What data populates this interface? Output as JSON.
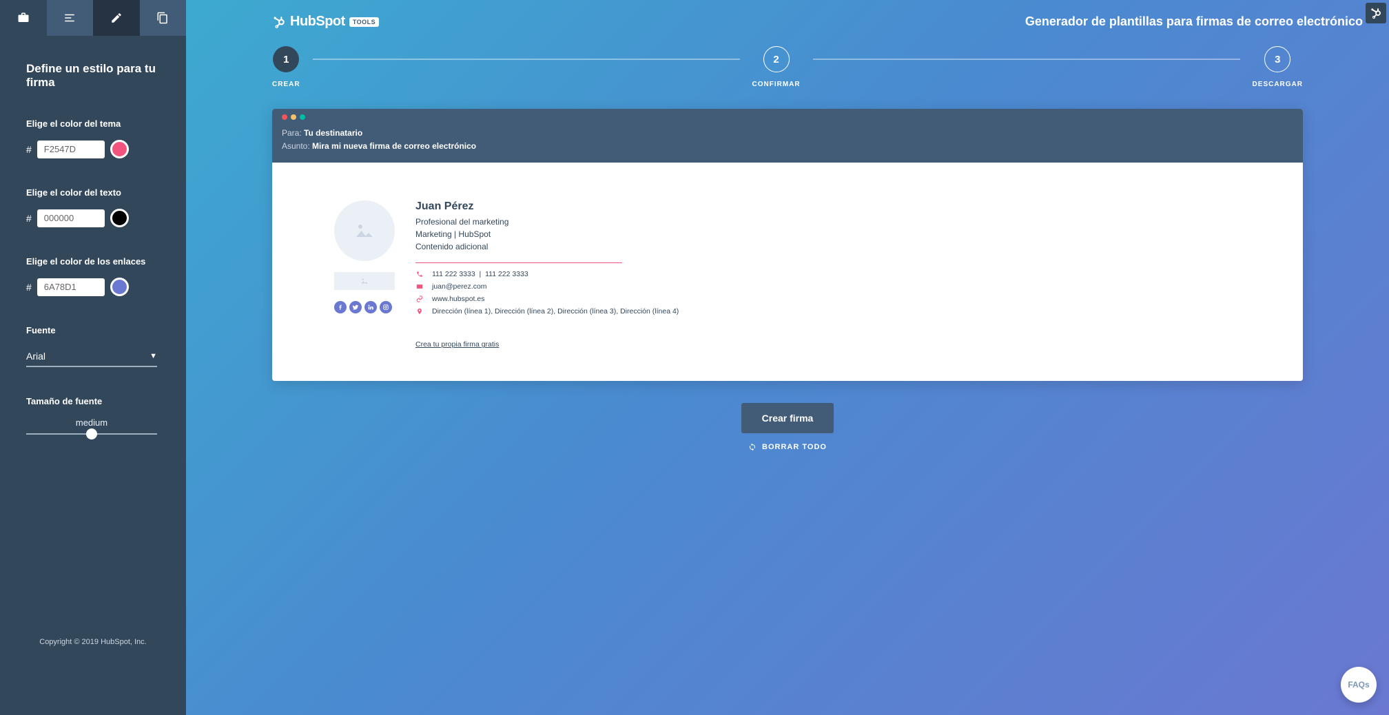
{
  "sidebar": {
    "heading": "Define un estilo para tu firma",
    "theme_color": {
      "label": "Elige el color del tema",
      "value": "F2547D",
      "hex": "#F2547D"
    },
    "text_color": {
      "label": "Elige el color del texto",
      "value": "000000",
      "hex": "#000000"
    },
    "link_color": {
      "label": "Elige el color de los enlaces",
      "value": "6A78D1",
      "hex": "#6A78D1"
    },
    "font": {
      "label": "Fuente",
      "value": "Arial"
    },
    "font_size": {
      "label": "Tamaño de fuente",
      "value": "medium"
    },
    "copyright": "Copyright © 2019 HubSpot, Inc."
  },
  "header": {
    "brand": "HubSpot",
    "tools_badge": "TOOLS",
    "title": "Generador de plantillas para firmas de correo electrónico"
  },
  "stepper": [
    {
      "num": "1",
      "label": "CREAR",
      "active": true
    },
    {
      "num": "2",
      "label": "CONFIRMAR",
      "active": false
    },
    {
      "num": "3",
      "label": "DESCARGAR",
      "active": false
    }
  ],
  "email_header": {
    "to_label": "Para:",
    "to_value": "Tu destinatario",
    "subject_label": "Asunto:",
    "subject_value": "Mira mi nueva firma de correo electrónico"
  },
  "signature": {
    "name": "Juan Pérez",
    "job": "Profesional del marketing",
    "dept_company": "Marketing | HubSpot",
    "extra": "Contenido adicional",
    "phone1": "111 222 3333",
    "phone2": "111 222 3333",
    "email": "juan@perez.com",
    "website": "www.hubspot.es",
    "address": "Dirección (línea 1), Dirección (línea 2), Dirección (línea 3), Dirección (línea 4)",
    "cta": "Crea tu propia firma gratis"
  },
  "actions": {
    "create": "Crear firma",
    "clear": "BORRAR TODO"
  },
  "faq": "FAQs"
}
